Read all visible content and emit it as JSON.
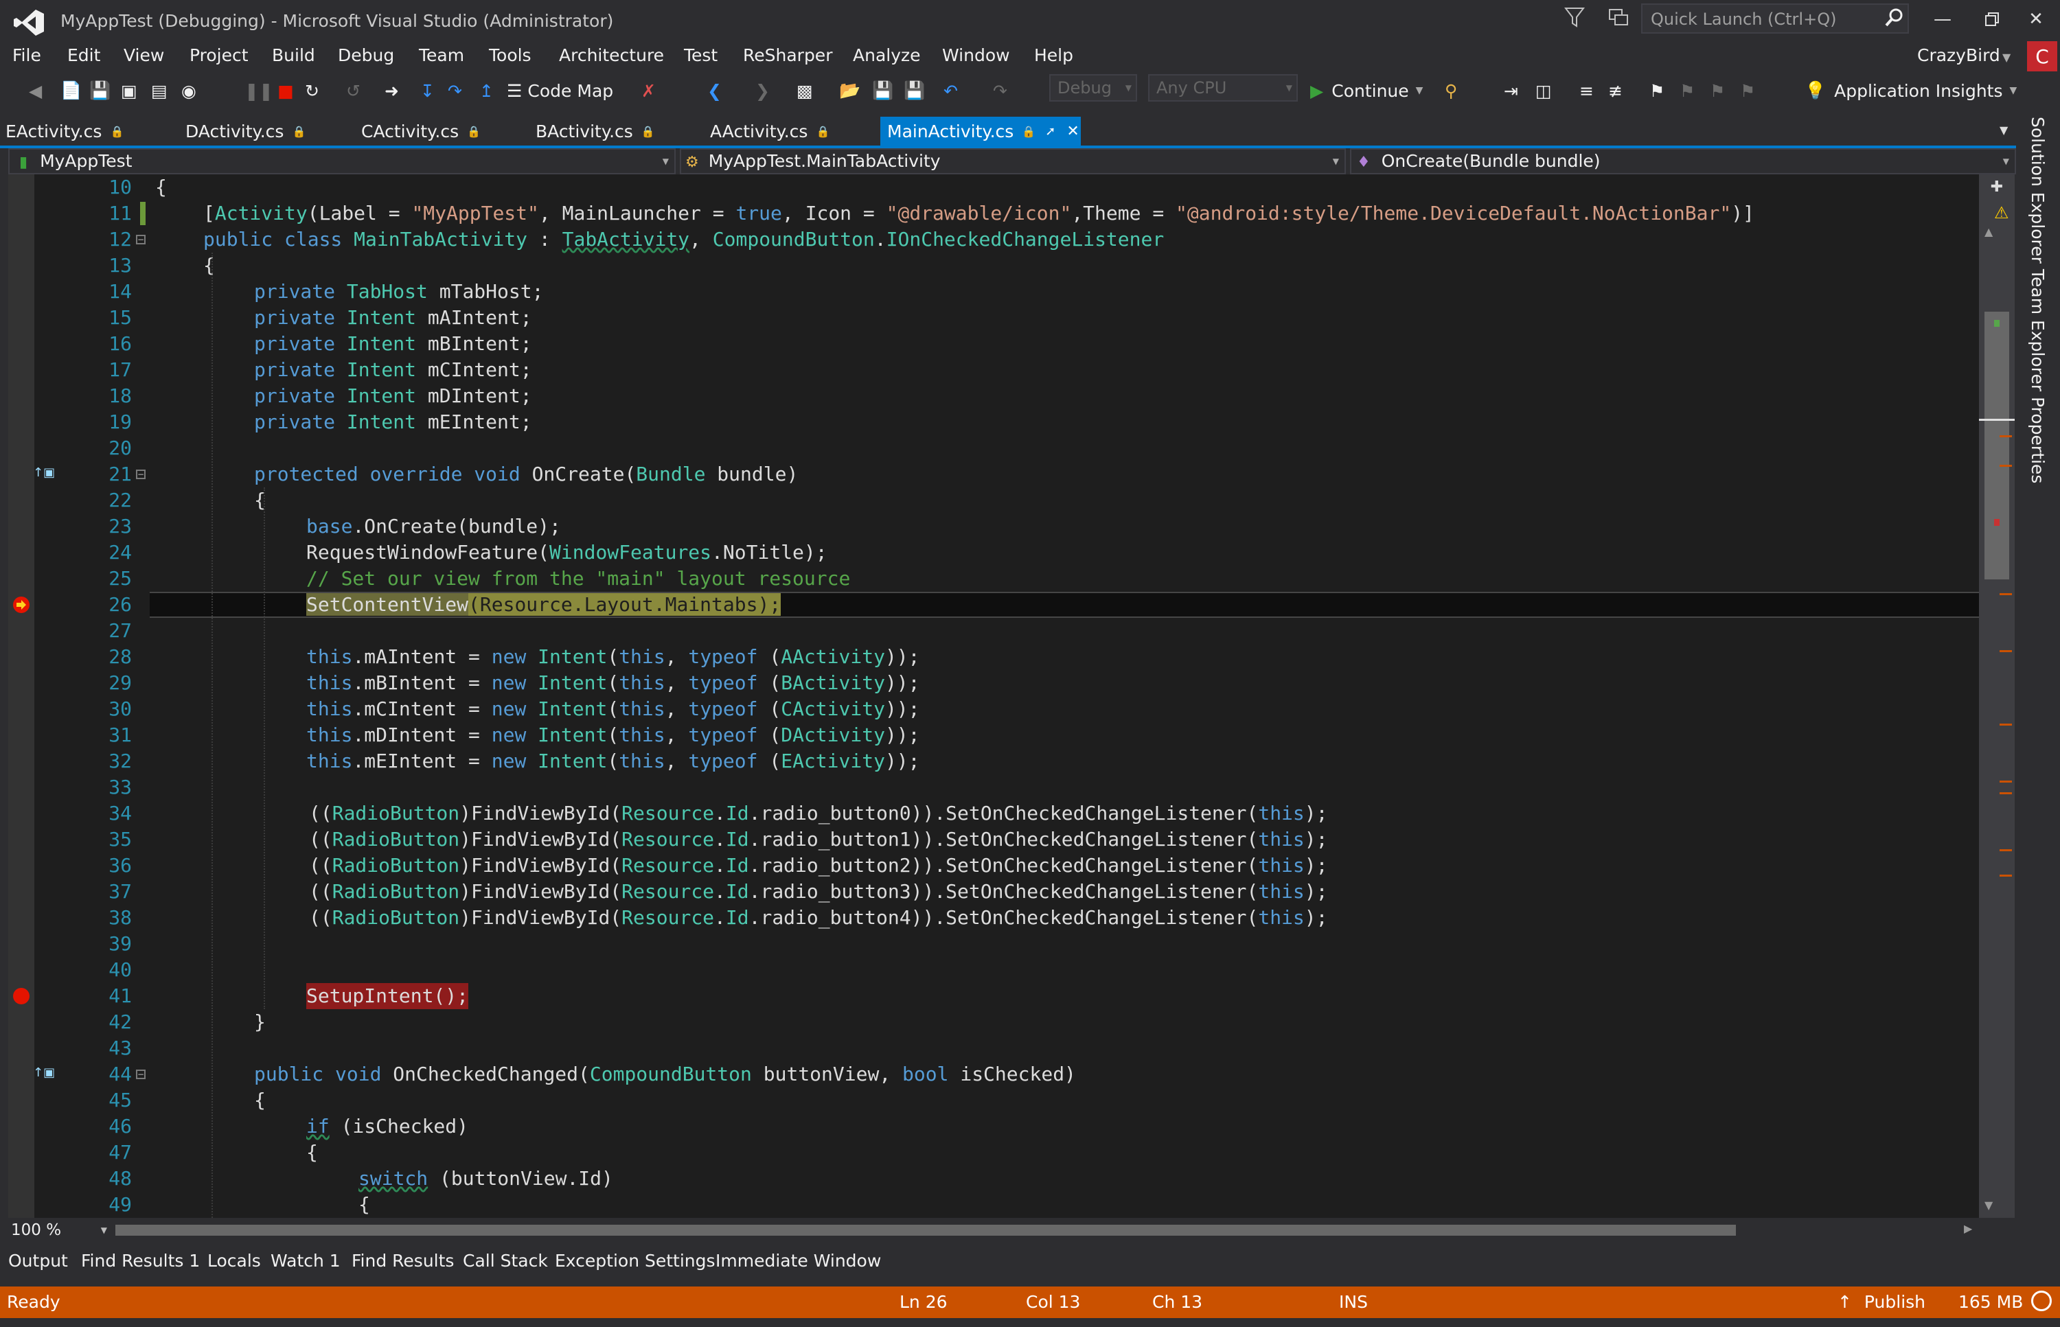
{
  "window": {
    "title": "MyAppTest (Debugging) - Microsoft Visual Studio (Administrator)",
    "quick_launch_placeholder": "Quick Launch (Ctrl+Q)",
    "user_name": "CrazyBird",
    "user_initial": "C"
  },
  "menu": [
    "File",
    "Edit",
    "View",
    "Project",
    "Build",
    "Debug",
    "Team",
    "Tools",
    "Architecture",
    "Test",
    "ReSharper",
    "Analyze",
    "Window",
    "Help"
  ],
  "toolbar": {
    "code_map_label": "Code Map",
    "config_value": "Debug",
    "platform_value": "Any CPU",
    "continue_label": "Continue",
    "app_insights_label": "Application Insights"
  },
  "tabs": [
    {
      "label": "EActivity.cs"
    },
    {
      "label": "DActivity.cs"
    },
    {
      "label": "CActivity.cs"
    },
    {
      "label": "BActivity.cs"
    },
    {
      "label": "AActivity.cs"
    },
    {
      "label": "MainActivity.cs",
      "active": true
    }
  ],
  "navbar": {
    "project": "MyAppTest",
    "type": "MyAppTest.MainTabActivity",
    "member": "OnCreate(Bundle bundle)"
  },
  "editor": {
    "zoom": "100 %",
    "current_line": 26,
    "breakpoint_line": 41,
    "lines": [
      {
        "n": "10"
      },
      {
        "n": "11"
      },
      {
        "n": "12"
      },
      {
        "n": "13"
      },
      {
        "n": "14"
      },
      {
        "n": "15"
      },
      {
        "n": "16"
      },
      {
        "n": "17"
      },
      {
        "n": "18"
      },
      {
        "n": "19"
      },
      {
        "n": "20"
      },
      {
        "n": "21"
      },
      {
        "n": "22"
      },
      {
        "n": "23"
      },
      {
        "n": "24"
      },
      {
        "n": "25"
      },
      {
        "n": "26"
      },
      {
        "n": "27"
      },
      {
        "n": "28"
      },
      {
        "n": "29"
      },
      {
        "n": "30"
      },
      {
        "n": "31"
      },
      {
        "n": "32"
      },
      {
        "n": "33"
      },
      {
        "n": "34"
      },
      {
        "n": "35"
      },
      {
        "n": "36"
      },
      {
        "n": "37"
      },
      {
        "n": "38"
      },
      {
        "n": "39"
      },
      {
        "n": "40"
      },
      {
        "n": "41"
      },
      {
        "n": "42"
      },
      {
        "n": "43"
      },
      {
        "n": "44"
      },
      {
        "n": "45"
      },
      {
        "n": "46"
      },
      {
        "n": "47"
      },
      {
        "n": "48"
      },
      {
        "n": "49"
      }
    ],
    "code": {
      "l10": "{",
      "l11a": "[",
      "l11b": "Activity",
      "l11c": "(Label = ",
      "l11d": "\"MyAppTest\"",
      "l11e": ", MainLauncher = ",
      "l11f": "true",
      "l11g": ", Icon = ",
      "l11h": "\"@drawable/icon\"",
      "l11i": ",Theme = ",
      "l11j": "\"@android:style/Theme.DeviceDefault.NoActionBar\"",
      "l11k": ")]",
      "l12a": "public class ",
      "l12b": "MainTabActivity",
      "l12c": " : ",
      "l12d": "TabActivity",
      "l12e": ", ",
      "l12f": "CompoundButton",
      "l12g": ".",
      "l12h": "IOnCheckedChangeListener",
      "l13": "{",
      "l14a": "private ",
      "l14b": "TabHost",
      "l14c": " mTabHost;",
      "l15a": "private ",
      "l15b": "Intent",
      "l15c": " mAIntent;",
      "l16a": "private ",
      "l16b": "Intent",
      "l16c": " mBIntent;",
      "l17a": "private ",
      "l17b": "Intent",
      "l17c": " mCIntent;",
      "l18a": "private ",
      "l18b": "Intent",
      "l18c": " mDIntent;",
      "l19a": "private ",
      "l19b": "Intent",
      "l19c": " mEIntent;",
      "l21a": "protected override void ",
      "l21b": "OnCreate(",
      "l21c": "Bundle",
      "l21d": " bundle)",
      "l22": "{",
      "l23a": "base",
      "l23b": ".OnCreate(bundle);",
      "l24a": "RequestWindowFeature(",
      "l24b": "WindowFeatures",
      "l24c": ".NoTitle);",
      "l25": "// Set our view from the \"main\" layout resource",
      "l26a": "SetContentView",
      "l26b": "(Resource.Layout.Maintabs);",
      "l28a": "this",
      "l28b": ".mAIntent = ",
      "l28c": "new ",
      "l28d": "Intent",
      "l28e": "(",
      "l28f": "this",
      "l28g": ", ",
      "l28h": "typeof",
      "l28i": " (",
      "l28j": "AActivity",
      "l28k": "));",
      "l29j": "BActivity",
      "l29b": ".mBIntent = ",
      "l30j": "CActivity",
      "l30b": ".mCIntent = ",
      "l31j": "DActivity",
      "l31b": ".mDIntent = ",
      "l32j": "EActivity",
      "l32b": ".mEIntent = ",
      "l34a": "((",
      "l34b": "RadioButton",
      "l34c": ")FindViewById(",
      "l34d": "Resource",
      "l34e": ".",
      "l34f": "Id",
      "l34g": ".radio_button0)).SetOnCheckedChangeListener(",
      "l34h": "this",
      "l34i": ");",
      "l35g": ".radio_button1)).SetOnCheckedChangeListener(",
      "l36g": ".radio_button2)).SetOnCheckedChangeListener(",
      "l37g": ".radio_button3)).SetOnCheckedChangeListener(",
      "l38g": ".radio_button4)).SetOnCheckedChangeListener(",
      "l41": "SetupIntent();",
      "l42": "}",
      "l44a": "public void ",
      "l44b": "OnCheckedChanged(",
      "l44c": "CompoundButton",
      "l44d": " buttonView, ",
      "l44e": "bool",
      "l44f": " isChecked)",
      "l45": "{",
      "l46a": "if",
      "l46b": " (isChecked)",
      "l47": "{",
      "l48a": "switch",
      "l48b": " (buttonView.Id)",
      "l49": "{"
    }
  },
  "side_tabs": [
    "Solution Explorer",
    "Team Explorer",
    "Properties"
  ],
  "bottom_tabs": [
    "Output",
    "Find Results 1",
    "Locals",
    "Watch 1",
    "Find Results",
    "Call Stack",
    "Exception Settings",
    "Immediate Window"
  ],
  "status": {
    "ready": "Ready",
    "ln": "Ln 26",
    "col": "Col 13",
    "ch": "Ch 13",
    "ins": "INS",
    "publish": "Publish",
    "memory": "165 MB"
  },
  "colors": {
    "accent": "#007acc",
    "status_bar": "#ca5100",
    "breakpoint": "#e51400"
  }
}
